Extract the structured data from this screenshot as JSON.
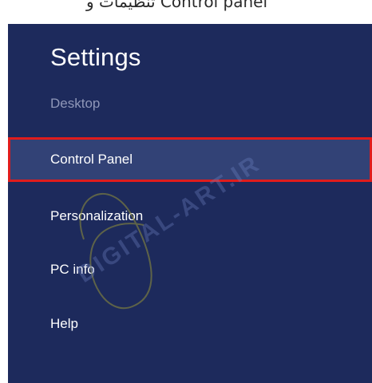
{
  "top_strip": {
    "text": "تنظیمات و Control panel"
  },
  "settings": {
    "title": "Settings",
    "subtitle": "Desktop",
    "items": [
      {
        "label": "Control Panel",
        "selected": true
      },
      {
        "label": "Personalization",
        "selected": false
      },
      {
        "label": "PC info",
        "selected": false
      },
      {
        "label": "Help",
        "selected": false
      }
    ]
  },
  "watermark": {
    "text": "DIGITAL-ART.IR"
  },
  "colors": {
    "panel_background": "#1d2a5c",
    "selected_background": "#324276",
    "highlight_border": "#e01c1c",
    "subtitle": "#8f97b8",
    "watermark": "#6d81c2"
  }
}
